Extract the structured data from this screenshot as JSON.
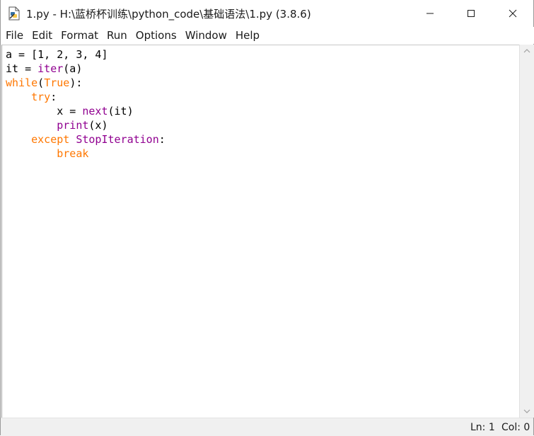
{
  "window": {
    "title": "1.py - H:\\蓝桥杯训练\\python_code\\基础语法\\1.py (3.8.6)"
  },
  "menu": {
    "items": [
      "File",
      "Edit",
      "Format",
      "Run",
      "Options",
      "Window",
      "Help"
    ]
  },
  "editor": {
    "lines": [
      [
        {
          "t": "a = [1, 2, 3, 4]",
          "c": "plain"
        }
      ],
      [
        {
          "t": "it = ",
          "c": "plain"
        },
        {
          "t": "iter",
          "c": "builtin"
        },
        {
          "t": "(a)",
          "c": "plain"
        }
      ],
      [
        {
          "t": "while",
          "c": "kw"
        },
        {
          "t": "(",
          "c": "plain"
        },
        {
          "t": "True",
          "c": "kw"
        },
        {
          "t": "):",
          "c": "plain"
        }
      ],
      [
        {
          "t": "    ",
          "c": "plain"
        },
        {
          "t": "try",
          "c": "kw"
        },
        {
          "t": ":",
          "c": "plain"
        }
      ],
      [
        {
          "t": "        x = ",
          "c": "plain"
        },
        {
          "t": "next",
          "c": "builtin"
        },
        {
          "t": "(it)",
          "c": "plain"
        }
      ],
      [
        {
          "t": "        ",
          "c": "plain"
        },
        {
          "t": "print",
          "c": "builtin"
        },
        {
          "t": "(x)",
          "c": "plain"
        }
      ],
      [
        {
          "t": "    ",
          "c": "plain"
        },
        {
          "t": "except",
          "c": "kw"
        },
        {
          "t": " ",
          "c": "plain"
        },
        {
          "t": "StopIteration",
          "c": "builtin"
        },
        {
          "t": ":",
          "c": "plain"
        }
      ],
      [
        {
          "t": "        ",
          "c": "plain"
        },
        {
          "t": "break",
          "c": "kw"
        }
      ]
    ]
  },
  "status": {
    "line": "Ln: 1",
    "col": "Col: 0"
  },
  "colors": {
    "keyword": "#ff7700",
    "builtin": "#900090",
    "text": "#000000"
  }
}
